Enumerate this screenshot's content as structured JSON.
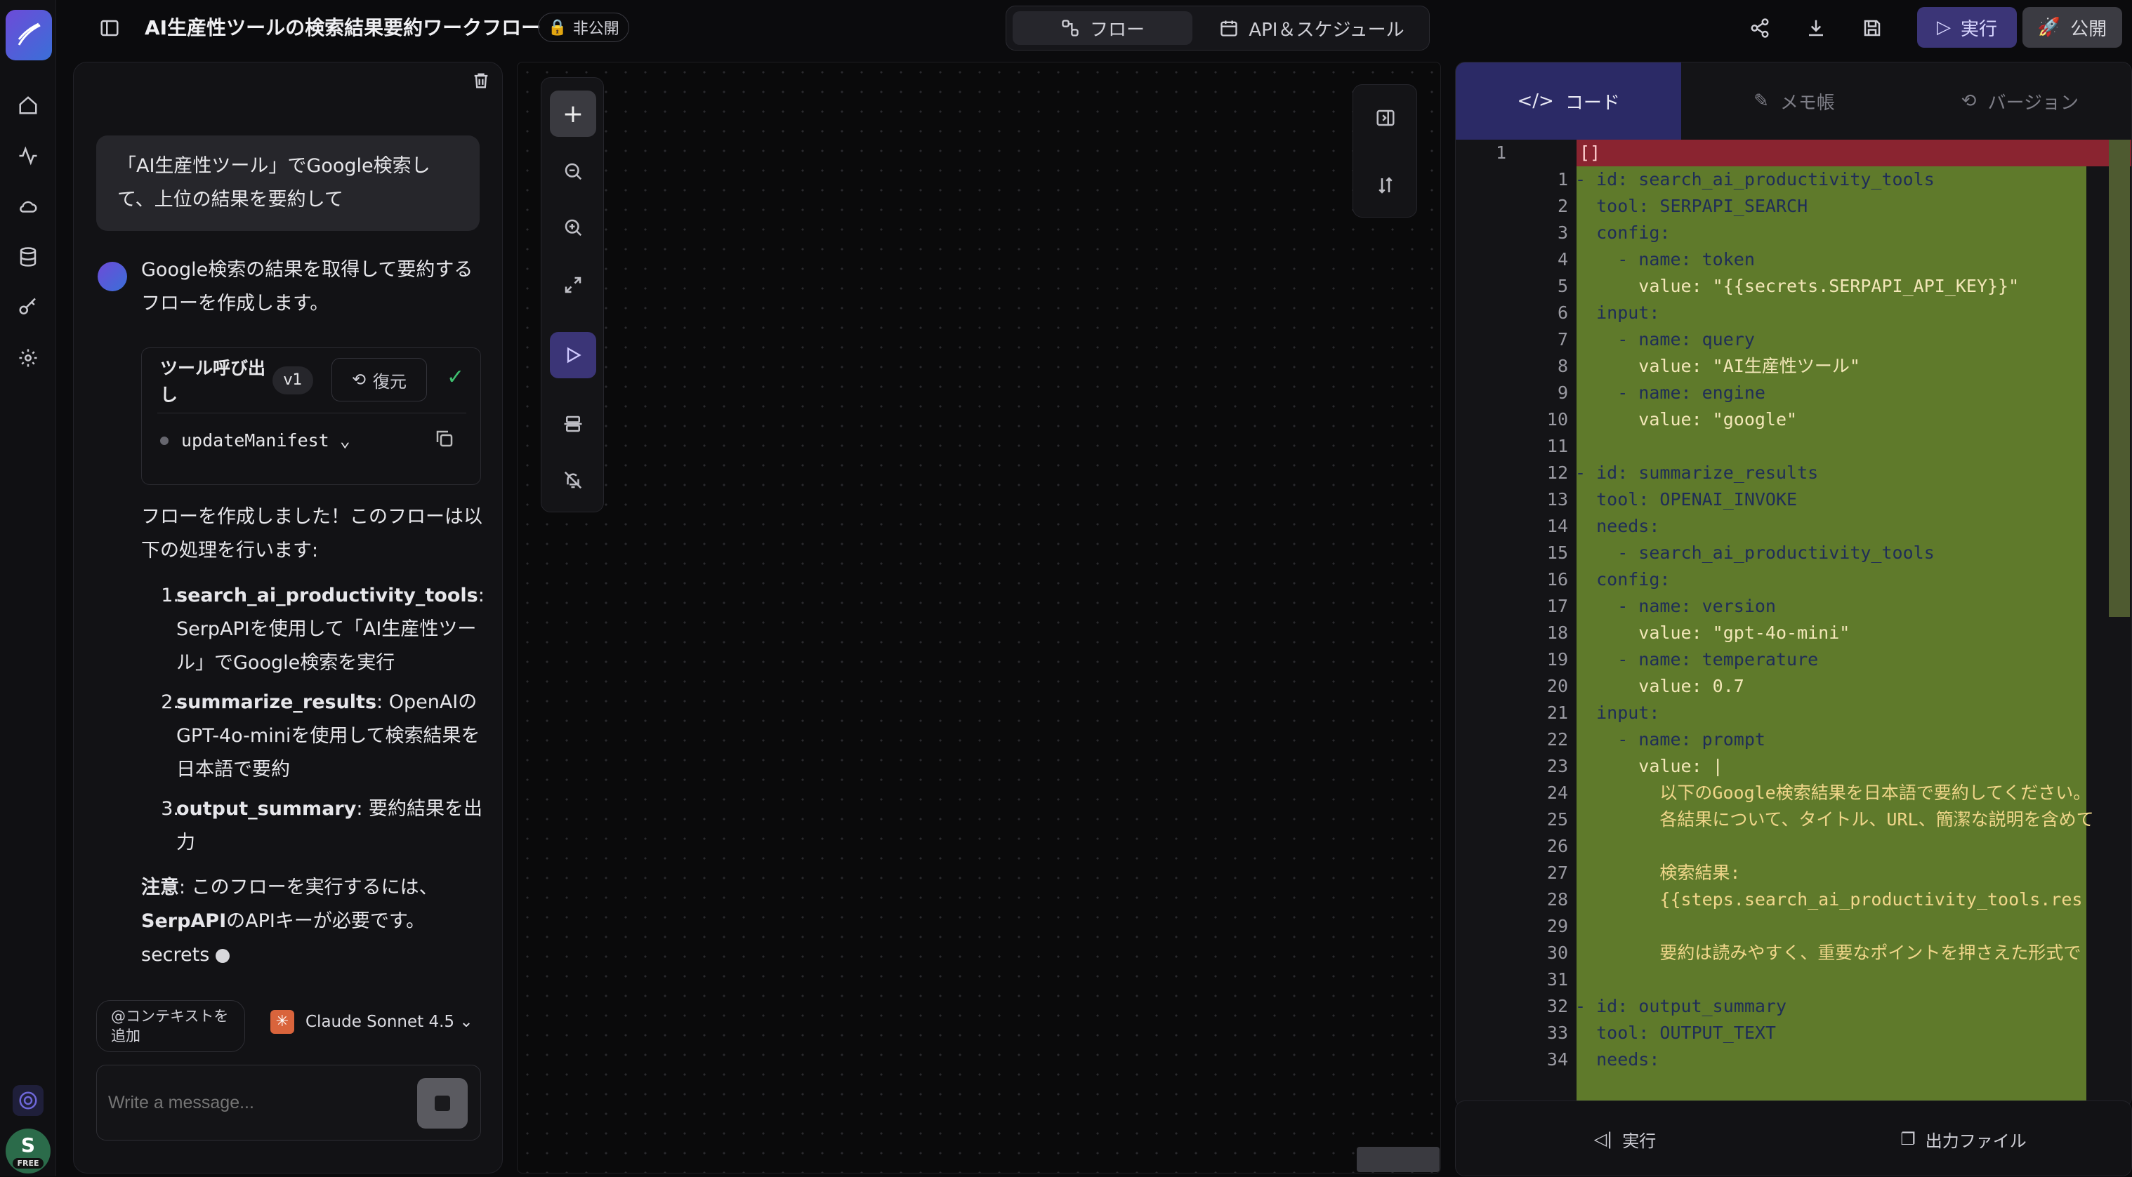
{
  "header": {
    "title": "AI生産性ツールの検索結果要約ワークフロー",
    "visibility": "非公開",
    "tab_flow": "フロー",
    "tab_api": "API＆スケジュール",
    "run": "実行",
    "publish": "公開"
  },
  "chat": {
    "user_msg": "「AI生産性ツール」でGoogle検索して、上位の結果を要約して",
    "assistant_intro": "Google検索の結果を取得して要約するフローを作成します。",
    "tool_call": {
      "title": "ツール呼び出し",
      "version": "v1",
      "restore": "復元",
      "function": "updateManifest"
    },
    "done_text": "フローを作成しました！このフローは以下の処理を行います:",
    "steps": [
      {
        "num": "1.",
        "name": "search_ai_productivity_tools",
        "desc": ": SerpAPIを使用して「AI生産性ツール」でGoogle検索を実行"
      },
      {
        "num": "2.",
        "name": "summarize_results",
        "desc": ": OpenAIのGPT-4o-miniを使用して検索結果を日本語で要約"
      },
      {
        "num": "3.",
        "name": "output_summary",
        "desc": ": 要約結果を出力"
      }
    ],
    "note_label": "注意",
    "note_text": ": このフローを実行するには、",
    "note_serp": "SerpAPI",
    "note_text2": "のAPIキーが必要です。",
    "note_secrets": "secrets",
    "context_btn": "@コンテキストを追加",
    "model": "Claude Sonnet 4.5",
    "input_placeholder": "Write a message..."
  },
  "editor": {
    "tab_code": "コード",
    "tab_memo": "メモ帳",
    "tab_version": "バージョン",
    "outer_line": "1",
    "outer_text": "[]",
    "lines": [
      {
        "n": "1",
        "t": "- id: search_ai_productivity_tools"
      },
      {
        "n": "2",
        "t": "  tool: SERPAPI_SEARCH"
      },
      {
        "n": "3",
        "t": "  config:"
      },
      {
        "n": "4",
        "t": "    - name: token"
      },
      {
        "n": "5",
        "t": "      value: \"{{secrets.SERPAPI_API_KEY}}\""
      },
      {
        "n": "6",
        "t": "  input:"
      },
      {
        "n": "7",
        "t": "    - name: query"
      },
      {
        "n": "8",
        "t": "      value: \"AI生産性ツール\""
      },
      {
        "n": "9",
        "t": "    - name: engine"
      },
      {
        "n": "10",
        "t": "      value: \"google\""
      },
      {
        "n": "11",
        "t": ""
      },
      {
        "n": "12",
        "t": "- id: summarize_results"
      },
      {
        "n": "13",
        "t": "  tool: OPENAI_INVOKE"
      },
      {
        "n": "14",
        "t": "  needs:"
      },
      {
        "n": "15",
        "t": "    - search_ai_productivity_tools"
      },
      {
        "n": "16",
        "t": "  config:"
      },
      {
        "n": "17",
        "t": "    - name: version"
      },
      {
        "n": "18",
        "t": "      value: \"gpt-4o-mini\""
      },
      {
        "n": "19",
        "t": "    - name: temperature"
      },
      {
        "n": "20",
        "t": "      value: 0.7"
      },
      {
        "n": "21",
        "t": "  input:"
      },
      {
        "n": "22",
        "t": "    - name: prompt"
      },
      {
        "n": "23",
        "t": "      value: |"
      },
      {
        "n": "24",
        "t": "        以下のGoogle検索結果を日本語で要約してください。"
      },
      {
        "n": "25",
        "t": "        各結果について、タイトル、URL、簡潔な説明を含めて"
      },
      {
        "n": "26",
        "t": ""
      },
      {
        "n": "27",
        "t": "        検索結果:"
      },
      {
        "n": "28",
        "t": "        {{steps.search_ai_productivity_tools.res"
      },
      {
        "n": "29",
        "t": ""
      },
      {
        "n": "30",
        "t": "        要約は読みやすく、重要なポイントを押さえた形式で"
      },
      {
        "n": "31",
        "t": ""
      },
      {
        "n": "32",
        "t": "- id: output_summary"
      },
      {
        "n": "33",
        "t": "  tool: OUTPUT_TEXT"
      },
      {
        "n": "34",
        "t": "  needs:"
      }
    ]
  },
  "bottom": {
    "run": "実行",
    "output": "出力ファイル"
  }
}
